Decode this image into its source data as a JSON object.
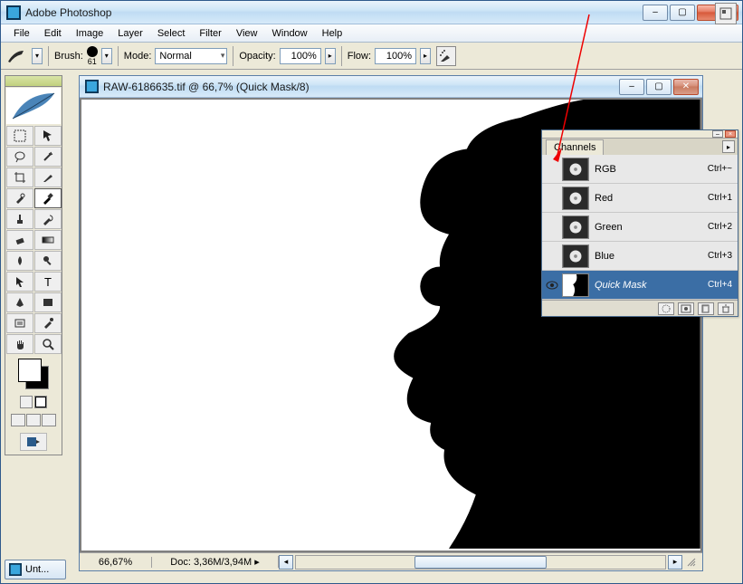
{
  "app": {
    "title": "Adobe Photoshop",
    "menus": [
      "File",
      "Edit",
      "Image",
      "Layer",
      "Select",
      "Filter",
      "View",
      "Window",
      "Help"
    ]
  },
  "options_bar": {
    "brush_label": "Brush:",
    "brush_size": "61",
    "mode_label": "Mode:",
    "mode_value": "Normal",
    "opacity_label": "Opacity:",
    "opacity_value": "100%",
    "flow_label": "Flow:",
    "flow_value": "100%"
  },
  "document": {
    "title": "RAW-6186635.tif @ 66,7% (Quick Mask/8)",
    "zoom": "66,67%",
    "doc_info": "Doc: 3,36M/3,94M"
  },
  "channels_panel": {
    "tab": "Channels",
    "rows": [
      {
        "name": "RGB",
        "shortcut": "Ctrl+~",
        "visible": false,
        "selected": false,
        "thumb": "flower"
      },
      {
        "name": "Red",
        "shortcut": "Ctrl+1",
        "visible": false,
        "selected": false,
        "thumb": "flower"
      },
      {
        "name": "Green",
        "shortcut": "Ctrl+2",
        "visible": false,
        "selected": false,
        "thumb": "flower"
      },
      {
        "name": "Blue",
        "shortcut": "Ctrl+3",
        "visible": false,
        "selected": false,
        "thumb": "flower"
      },
      {
        "name": "Quick Mask",
        "shortcut": "Ctrl+4",
        "visible": true,
        "selected": true,
        "thumb": "mask"
      }
    ]
  },
  "taskbar": {
    "button": "Unt..."
  }
}
